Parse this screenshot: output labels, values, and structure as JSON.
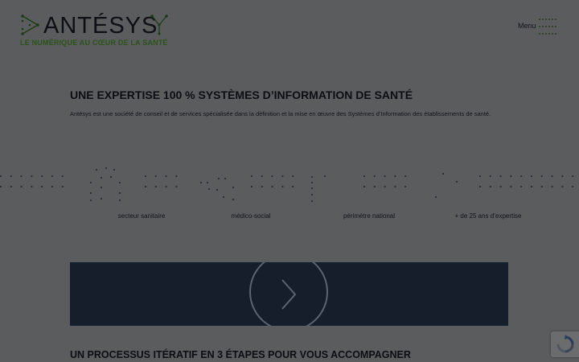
{
  "header": {
    "brand": "ANTÉSYS",
    "tagline": "LE NUMÉRIQUE AU CŒUR DE LA SANTÉ",
    "menu_label": "Menu",
    "logo_icon": "dots-network-icon",
    "menu_icon": "dotted-hamburger-icon"
  },
  "expertise": {
    "title": "UNE EXPERTISE 100 % SYSTÈMES D’INFORMATION DE SANTÉ",
    "intro": "Antésys est une société de conseil et de services spécialisée dans la définition et la mise en œuvre des Systèmes d’Information des établissements de santé.",
    "stats": [
      {
        "label": "secteur sanitaire"
      },
      {
        "label": "médico-social"
      },
      {
        "label": "périmètre national"
      },
      {
        "label": "+ de 25 ans d’expertise"
      }
    ]
  },
  "video": {
    "play_icon": "chevron-right-icon"
  },
  "process": {
    "title": "UN PROCESSUS ITÉRATIF EN 3 ÉTAPES POUR VOUS ACCOMPAGNER"
  },
  "colors": {
    "background": "#5a5c5e",
    "brand_green": "#2c5318",
    "dark_navy": "#161e2b"
  }
}
